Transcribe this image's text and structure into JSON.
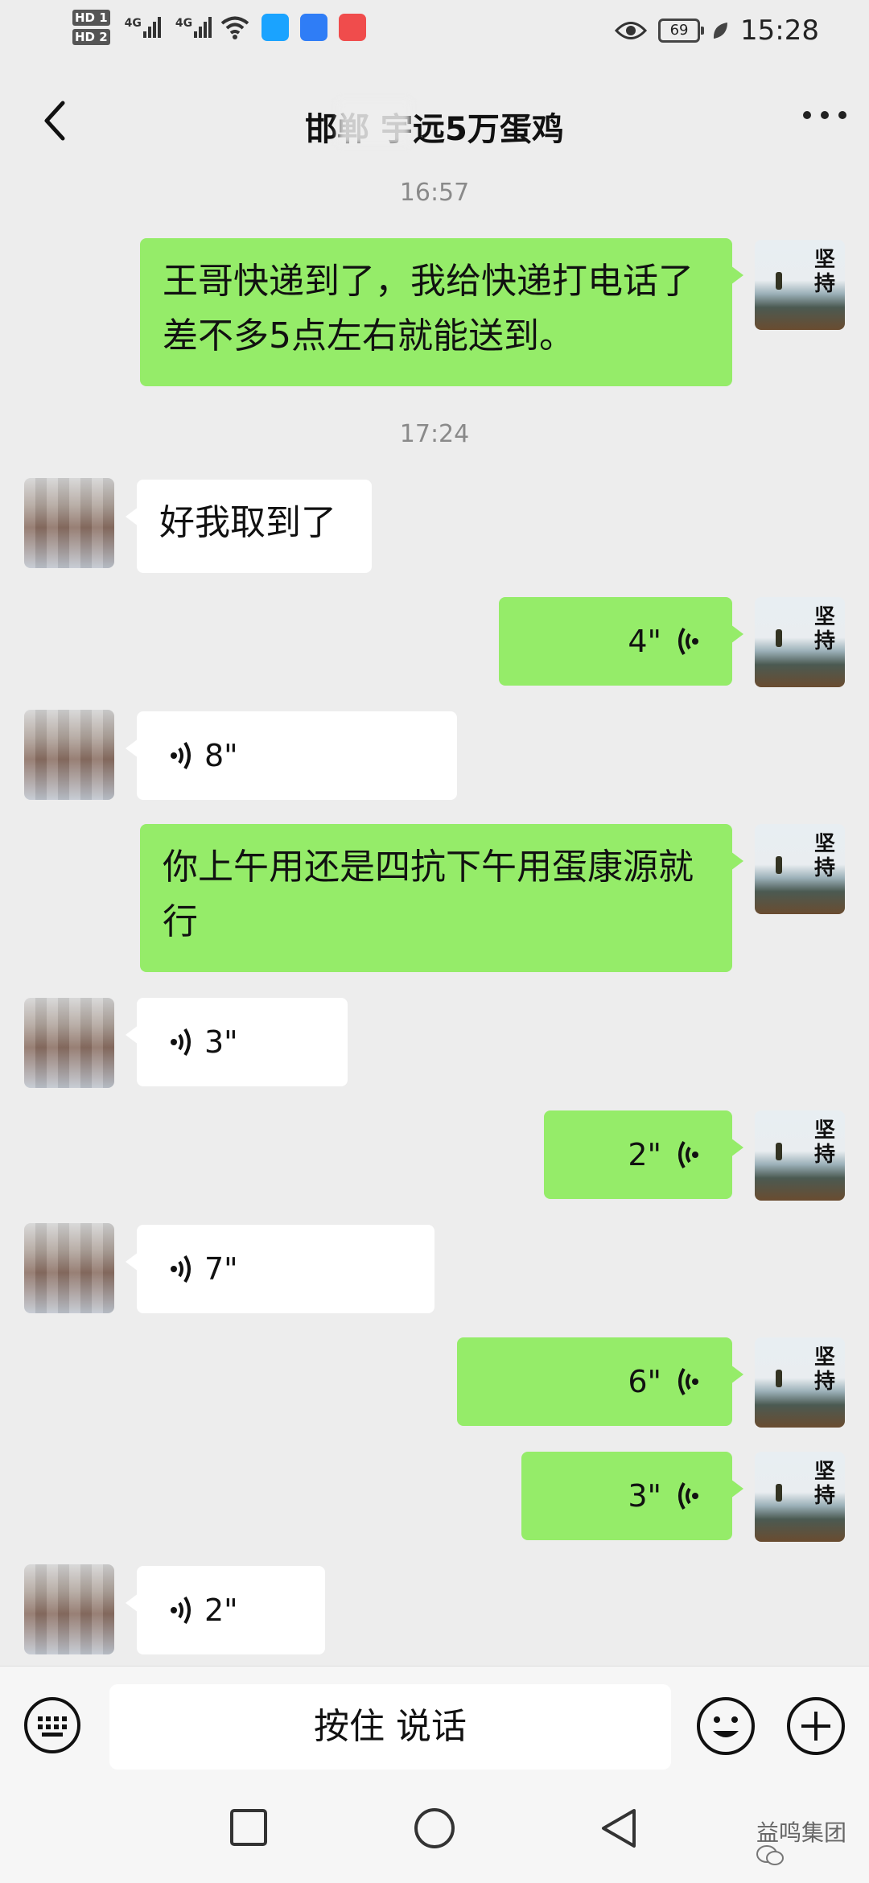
{
  "status_bar": {
    "sim1": "HD 1",
    "sim2": "HD 2",
    "net1": "4G",
    "net2": "4G",
    "battery": "69",
    "time": "15:28"
  },
  "header": {
    "title": "邯郸      宇远5万蛋鸡"
  },
  "messages": {
    "t1": "16:57",
    "m1": "王哥快递到了，我给快递打电话了差不多5点左右就能送到。",
    "t2": "17:24",
    "m2": "好我取到了",
    "v1": "4\"",
    "v2": "8\"",
    "m3": "你上午用还是四抗下午用蛋康源就行",
    "v3": "3\"",
    "v4": "2\"",
    "v5": "7\"",
    "v6": "6\"",
    "v7": "3\"",
    "v8": "2\""
  },
  "avatar_self": {
    "text1": "坚",
    "text2": "持"
  },
  "input_bar": {
    "hold_to_talk": "按住 说话"
  },
  "watermark": "益鸣集团",
  "colors": {
    "bubble_out": "#95ec69",
    "bubble_in": "#ffffff",
    "background": "#ededed"
  }
}
